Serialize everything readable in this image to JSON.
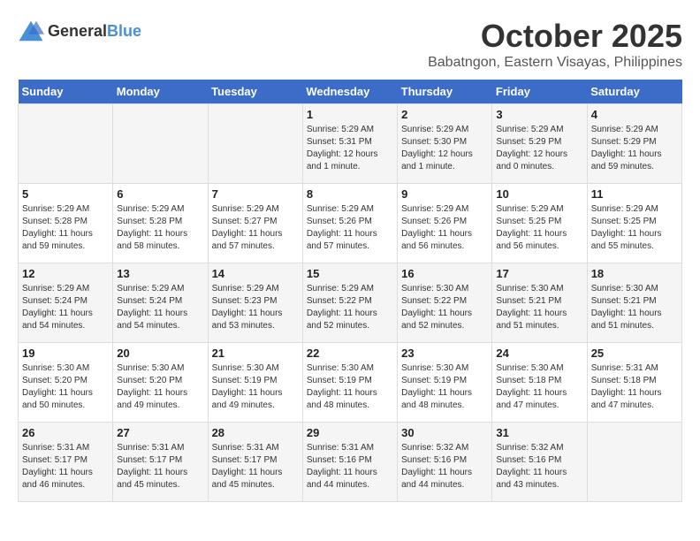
{
  "logo": {
    "general": "General",
    "blue": "Blue"
  },
  "title": {
    "month": "October 2025",
    "location": "Babatngon, Eastern Visayas, Philippines"
  },
  "headers": [
    "Sunday",
    "Monday",
    "Tuesday",
    "Wednesday",
    "Thursday",
    "Friday",
    "Saturday"
  ],
  "weeks": [
    [
      {
        "day": "",
        "info": ""
      },
      {
        "day": "",
        "info": ""
      },
      {
        "day": "",
        "info": ""
      },
      {
        "day": "1",
        "info": "Sunrise: 5:29 AM\nSunset: 5:31 PM\nDaylight: 12 hours\nand 1 minute."
      },
      {
        "day": "2",
        "info": "Sunrise: 5:29 AM\nSunset: 5:30 PM\nDaylight: 12 hours\nand 1 minute."
      },
      {
        "day": "3",
        "info": "Sunrise: 5:29 AM\nSunset: 5:29 PM\nDaylight: 12 hours\nand 0 minutes."
      },
      {
        "day": "4",
        "info": "Sunrise: 5:29 AM\nSunset: 5:29 PM\nDaylight: 11 hours\nand 59 minutes."
      }
    ],
    [
      {
        "day": "5",
        "info": "Sunrise: 5:29 AM\nSunset: 5:28 PM\nDaylight: 11 hours\nand 59 minutes."
      },
      {
        "day": "6",
        "info": "Sunrise: 5:29 AM\nSunset: 5:28 PM\nDaylight: 11 hours\nand 58 minutes."
      },
      {
        "day": "7",
        "info": "Sunrise: 5:29 AM\nSunset: 5:27 PM\nDaylight: 11 hours\nand 57 minutes."
      },
      {
        "day": "8",
        "info": "Sunrise: 5:29 AM\nSunset: 5:26 PM\nDaylight: 11 hours\nand 57 minutes."
      },
      {
        "day": "9",
        "info": "Sunrise: 5:29 AM\nSunset: 5:26 PM\nDaylight: 11 hours\nand 56 minutes."
      },
      {
        "day": "10",
        "info": "Sunrise: 5:29 AM\nSunset: 5:25 PM\nDaylight: 11 hours\nand 56 minutes."
      },
      {
        "day": "11",
        "info": "Sunrise: 5:29 AM\nSunset: 5:25 PM\nDaylight: 11 hours\nand 55 minutes."
      }
    ],
    [
      {
        "day": "12",
        "info": "Sunrise: 5:29 AM\nSunset: 5:24 PM\nDaylight: 11 hours\nand 54 minutes."
      },
      {
        "day": "13",
        "info": "Sunrise: 5:29 AM\nSunset: 5:24 PM\nDaylight: 11 hours\nand 54 minutes."
      },
      {
        "day": "14",
        "info": "Sunrise: 5:29 AM\nSunset: 5:23 PM\nDaylight: 11 hours\nand 53 minutes."
      },
      {
        "day": "15",
        "info": "Sunrise: 5:29 AM\nSunset: 5:22 PM\nDaylight: 11 hours\nand 52 minutes."
      },
      {
        "day": "16",
        "info": "Sunrise: 5:30 AM\nSunset: 5:22 PM\nDaylight: 11 hours\nand 52 minutes."
      },
      {
        "day": "17",
        "info": "Sunrise: 5:30 AM\nSunset: 5:21 PM\nDaylight: 11 hours\nand 51 minutes."
      },
      {
        "day": "18",
        "info": "Sunrise: 5:30 AM\nSunset: 5:21 PM\nDaylight: 11 hours\nand 51 minutes."
      }
    ],
    [
      {
        "day": "19",
        "info": "Sunrise: 5:30 AM\nSunset: 5:20 PM\nDaylight: 11 hours\nand 50 minutes."
      },
      {
        "day": "20",
        "info": "Sunrise: 5:30 AM\nSunset: 5:20 PM\nDaylight: 11 hours\nand 49 minutes."
      },
      {
        "day": "21",
        "info": "Sunrise: 5:30 AM\nSunset: 5:19 PM\nDaylight: 11 hours\nand 49 minutes."
      },
      {
        "day": "22",
        "info": "Sunrise: 5:30 AM\nSunset: 5:19 PM\nDaylight: 11 hours\nand 48 minutes."
      },
      {
        "day": "23",
        "info": "Sunrise: 5:30 AM\nSunset: 5:19 PM\nDaylight: 11 hours\nand 48 minutes."
      },
      {
        "day": "24",
        "info": "Sunrise: 5:30 AM\nSunset: 5:18 PM\nDaylight: 11 hours\nand 47 minutes."
      },
      {
        "day": "25",
        "info": "Sunrise: 5:31 AM\nSunset: 5:18 PM\nDaylight: 11 hours\nand 47 minutes."
      }
    ],
    [
      {
        "day": "26",
        "info": "Sunrise: 5:31 AM\nSunset: 5:17 PM\nDaylight: 11 hours\nand 46 minutes."
      },
      {
        "day": "27",
        "info": "Sunrise: 5:31 AM\nSunset: 5:17 PM\nDaylight: 11 hours\nand 45 minutes."
      },
      {
        "day": "28",
        "info": "Sunrise: 5:31 AM\nSunset: 5:17 PM\nDaylight: 11 hours\nand 45 minutes."
      },
      {
        "day": "29",
        "info": "Sunrise: 5:31 AM\nSunset: 5:16 PM\nDaylight: 11 hours\nand 44 minutes."
      },
      {
        "day": "30",
        "info": "Sunrise: 5:32 AM\nSunset: 5:16 PM\nDaylight: 11 hours\nand 44 minutes."
      },
      {
        "day": "31",
        "info": "Sunrise: 5:32 AM\nSunset: 5:16 PM\nDaylight: 11 hours\nand 43 minutes."
      },
      {
        "day": "",
        "info": ""
      }
    ]
  ]
}
